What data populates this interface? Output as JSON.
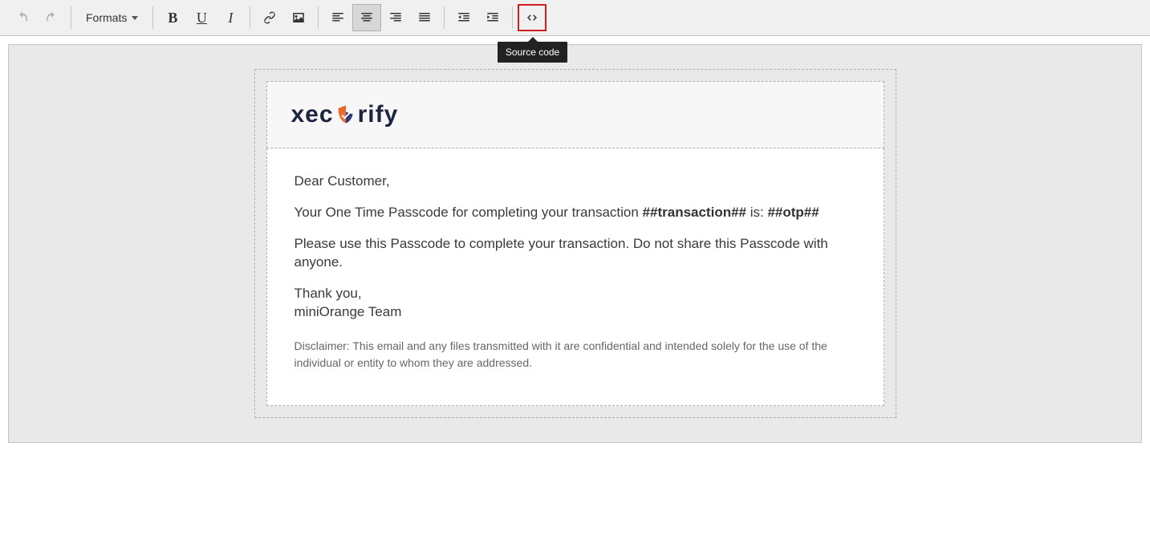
{
  "toolbar": {
    "formats_label": "Formats",
    "bold_glyph": "B",
    "underline_glyph": "U",
    "italic_glyph": "I",
    "tooltip_source_code": "Source code"
  },
  "email": {
    "brand_left": "xec",
    "brand_right": "rify",
    "greeting": "Dear Customer,",
    "line1_a": "Your One Time Passcode for completing your transaction ",
    "line1_b": "##transaction##",
    "line1_c": " is: ",
    "line1_d": "##otp##",
    "line2": "Please use this Passcode to complete your transaction. Do not share this Passcode with anyone.",
    "thanks1": "Thank you,",
    "thanks2": "miniOrange Team",
    "disclaimer": "Disclaimer: This email and any files transmitted with it are confidential and intended solely for the use of the individual or entity to whom they are addressed."
  }
}
